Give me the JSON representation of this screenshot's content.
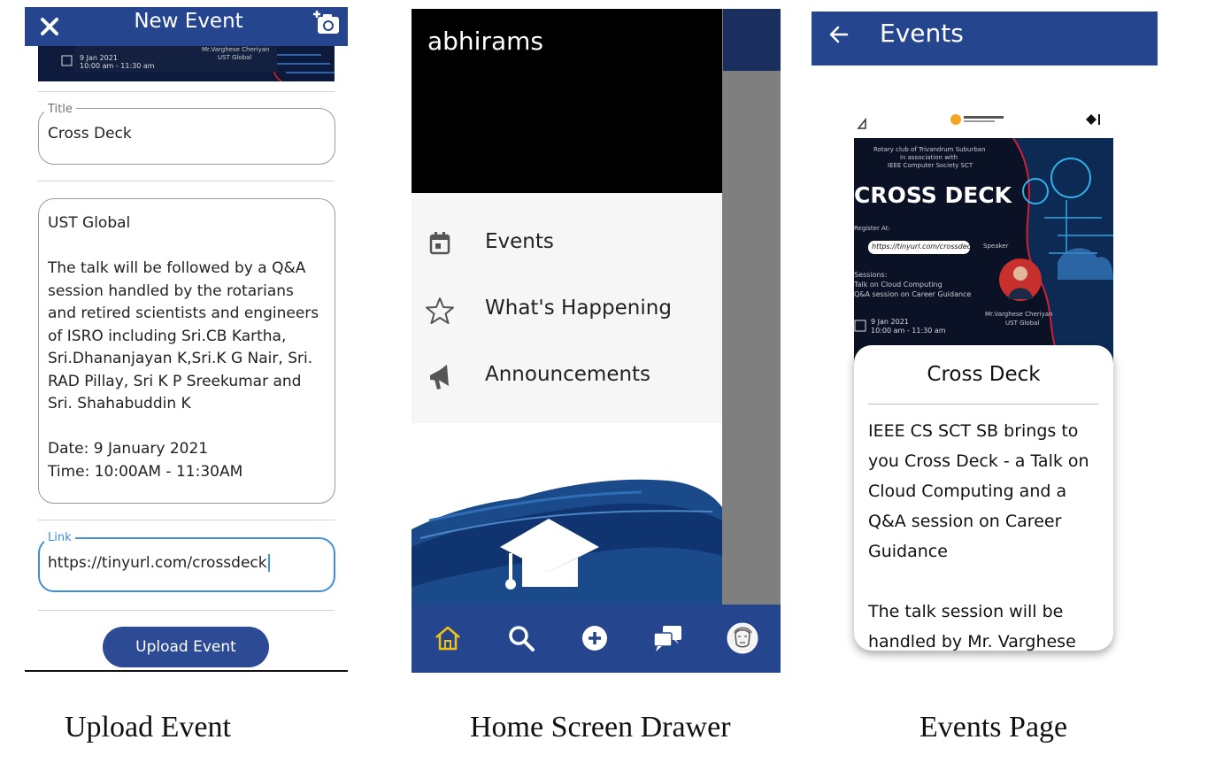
{
  "upload_event": {
    "header": {
      "title": "New Event",
      "close_icon": "close-icon",
      "camera_icon": "add-photo-icon"
    },
    "banner": {
      "date": "9 Jan 2021",
      "time": "10:00 am - 11:30 am",
      "speaker": "Mr.Varghese Cheriyan",
      "org": "UST Global"
    },
    "title_field": {
      "label": "Title",
      "value": "Cross Deck"
    },
    "description_field": {
      "value": "UST Global\n\nThe talk will be followed by a Q&A session handled by the rotarians and retired scientists and engineers of ISRO including Sri.CB Kartha, Sri.Dhananjayan K,Sri.K G Nair, Sri. RAD Pillay, Sri K P Sreekumar and Sri. Shahabuddin K\n\nDate: 9 January 2021\nTime: 10:00AM - 11:30AM"
    },
    "link_field": {
      "label": "Link",
      "value": "https://tinyurl.com/crossdeck"
    },
    "upload_button": "Upload Event",
    "caption": "Upload Event"
  },
  "home_drawer": {
    "username": "abhirams",
    "menu": [
      {
        "label": "Events",
        "icon": "calendar-icon"
      },
      {
        "label": "What's Happening",
        "icon": "star-icon"
      },
      {
        "label": "Announcements",
        "icon": "megaphone-icon"
      }
    ],
    "bottom_nav": [
      "home-icon",
      "search-icon",
      "add-circle-icon",
      "chat-icon",
      "profile-avatar-icon"
    ],
    "caption": "Home Screen Drawer",
    "accent": "#f2c40f"
  },
  "events_page": {
    "header": {
      "title": "Events",
      "back_icon": "back-arrow-icon"
    },
    "poster": {
      "org_line1": "Rotary club of Trivandrum Suburban",
      "org_line2": "in association with",
      "org_line3": "IEEE Computer Society SCT",
      "title": "CROSS DECK",
      "register_label": "Register At:",
      "register_url": "https://tinyurl.com/crossdeck",
      "speaker_label": "Speaker",
      "sessions_label": "Sessions:",
      "session1": "Talk on Cloud Computing",
      "session2": "Q&A session on Career Guidance",
      "date": "9 Jan 2021",
      "time": "10:00 am - 11:30 am",
      "speaker_name": "Mr.Varghese Cheriyan",
      "speaker_org": "UST Global"
    },
    "card": {
      "title": "Cross Deck",
      "body": "IEEE CS SCT SB brings to you Cross Deck - a Talk on Cloud Computing and a Q&A session on Career Guidance\n\nThe talk session will be handled by Mr. Varghese Cherian"
    },
    "caption": "Events Page"
  },
  "colors": {
    "primary": "#26458f",
    "dark_navy": "#1b2f5f",
    "accent_yellow": "#f2c40f"
  }
}
